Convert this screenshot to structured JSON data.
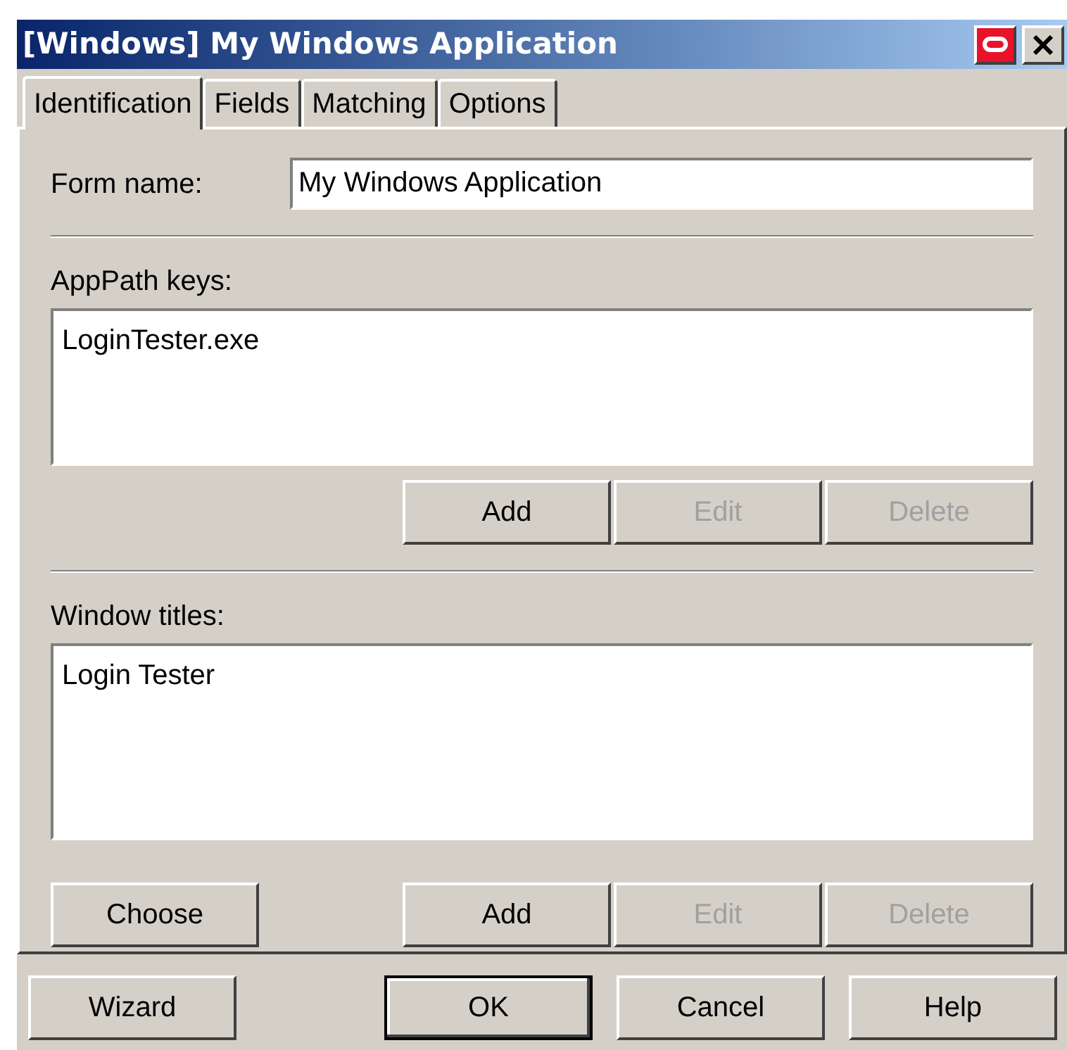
{
  "window": {
    "title": "[Windows] My Windows Application"
  },
  "tabs": [
    {
      "label": "Identification",
      "selected": true
    },
    {
      "label": "Fields",
      "selected": false
    },
    {
      "label": "Matching",
      "selected": false
    },
    {
      "label": "Options",
      "selected": false
    }
  ],
  "form_name": {
    "label": "Form name:",
    "value": "My Windows Application"
  },
  "sections": [
    {
      "label": "AppPath keys:",
      "items": [
        "LoginTester.exe"
      ],
      "buttons": [
        {
          "label": "Add",
          "disabled": false
        },
        {
          "label": "Edit",
          "disabled": true
        },
        {
          "label": "Delete",
          "disabled": true
        }
      ]
    },
    {
      "label": "Window titles:",
      "items": [
        "Login Tester"
      ],
      "extra_button": {
        "label": "Choose",
        "disabled": false
      },
      "buttons": [
        {
          "label": "Add",
          "disabled": false
        },
        {
          "label": "Edit",
          "disabled": true
        },
        {
          "label": "Delete",
          "disabled": true
        }
      ]
    }
  ],
  "footer_buttons": [
    {
      "label": "Wizard",
      "default": false
    },
    {
      "label": "OK",
      "default": true
    },
    {
      "label": "Cancel",
      "default": false
    },
    {
      "label": "Help",
      "default": false
    }
  ]
}
